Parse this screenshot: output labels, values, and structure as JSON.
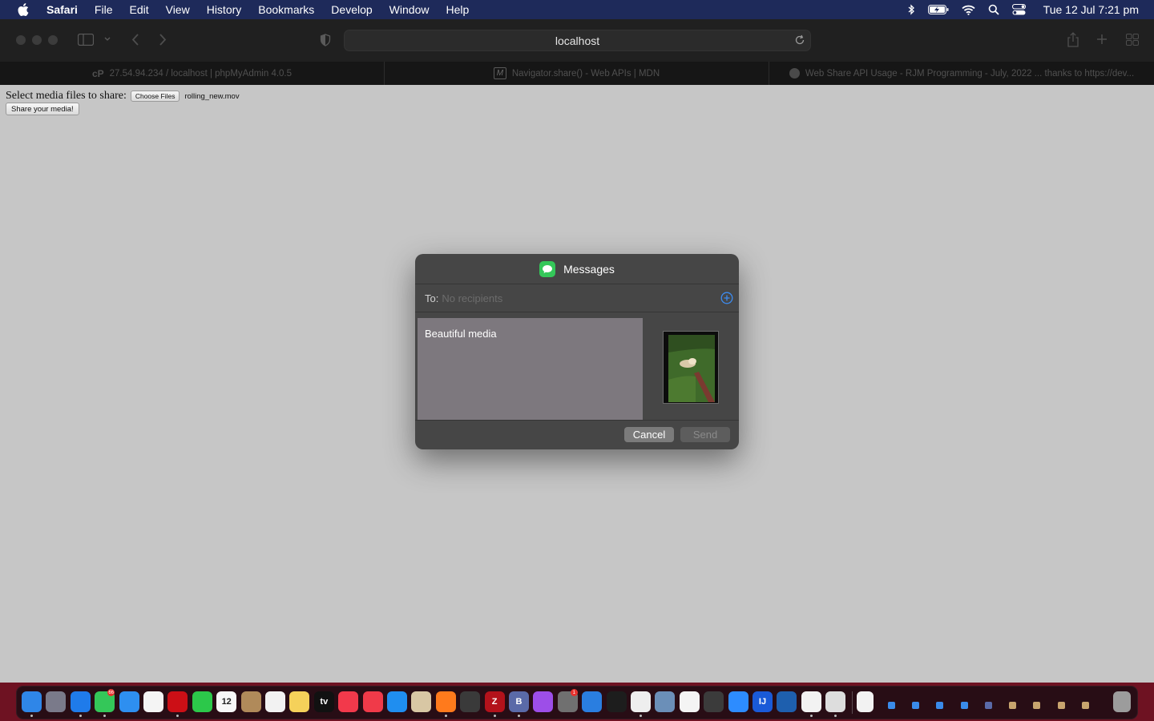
{
  "menubar": {
    "app_name": "Safari",
    "items": [
      "File",
      "Edit",
      "View",
      "History",
      "Bookmarks",
      "Develop",
      "Window",
      "Help"
    ],
    "status_icons": [
      "bluetooth-icon",
      "battery-icon",
      "wifi-icon",
      "spotlight-icon",
      "control-center-icon"
    ],
    "clock": "Tue 12 Jul  7:21 pm"
  },
  "browser": {
    "address": "localhost",
    "tabs": [
      {
        "icon": "cpanel",
        "icon_text": "cP",
        "title": "27.54.94.234 / localhost | phpMyAdmin 4.0.5"
      },
      {
        "icon": "mdn",
        "icon_text": "M",
        "title": "Navigator.share() - Web APIs | MDN"
      },
      {
        "icon": "rjm",
        "icon_text": "",
        "title": "Web Share API Usage - RJM Programming - July, 2022 ... thanks to https://dev..."
      }
    ]
  },
  "page": {
    "prompt": "Select media files to share:",
    "choose_label": "Choose Files",
    "filename": "rolling_new.mov",
    "share_label": "Share your media!"
  },
  "share_sheet": {
    "title": "Messages",
    "to_label": "To:",
    "to_placeholder": "No recipients",
    "message": "Beautiful media",
    "cancel_label": "Cancel",
    "send_label": "Send"
  },
  "dock": {
    "items": [
      {
        "name": "finder",
        "color": "#2f86e8",
        "running": true
      },
      {
        "name": "launchpad",
        "color": "#7a7a8a",
        "running": false
      },
      {
        "name": "safari",
        "color": "#1f7bea",
        "running": true
      },
      {
        "name": "messages",
        "color": "#34c759",
        "running": true,
        "badge": "66"
      },
      {
        "name": "mail",
        "color": "#2e8ff0",
        "running": false
      },
      {
        "name": "photos",
        "color": "#f4f4f4",
        "running": false
      },
      {
        "name": "opera",
        "color": "#cc0f16",
        "running": true
      },
      {
        "name": "facetime",
        "color": "#2cc84a",
        "running": false
      },
      {
        "name": "calendar",
        "color": "#f7f7f7",
        "running": false,
        "text": "12"
      },
      {
        "name": "contacts",
        "color": "#b08a5a",
        "running": false
      },
      {
        "name": "reminders",
        "color": "#f2f2f2",
        "running": false
      },
      {
        "name": "notes",
        "color": "#f5d15a",
        "running": false
      },
      {
        "name": "tv",
        "color": "#111111",
        "running": false,
        "text": "tv"
      },
      {
        "name": "music",
        "color": "#f2394b",
        "running": false
      },
      {
        "name": "news",
        "color": "#f03a49",
        "running": false
      },
      {
        "name": "app-store",
        "color": "#1f8ef0",
        "running": false
      },
      {
        "name": "chess",
        "color": "#d8c7a4",
        "running": false
      },
      {
        "name": "firefox",
        "color": "#ff7a1c",
        "running": true
      },
      {
        "name": "calculator",
        "color": "#3a3a3a",
        "running": false
      },
      {
        "name": "filezilla",
        "color": "#b3121b",
        "running": true,
        "text": "Z"
      },
      {
        "name": "bbedit",
        "color": "#5a6aa8",
        "running": true,
        "text": "B"
      },
      {
        "name": "podcasts",
        "color": "#9d4ee8",
        "running": false
      },
      {
        "name": "system-preferences",
        "color": "#707070",
        "running": false,
        "badge": "1"
      },
      {
        "name": "xcode",
        "color": "#2a7ee0",
        "running": false
      },
      {
        "name": "terminal",
        "color": "#1d1d1d",
        "running": false
      },
      {
        "name": "gimp",
        "color": "#eeeeee",
        "running": true
      },
      {
        "name": "preview",
        "color": "#6b8fb8",
        "running": false
      },
      {
        "name": "textedit",
        "color": "#f4f4f4",
        "running": false
      },
      {
        "name": "script-editor",
        "color": "#3b3b3b",
        "running": false
      },
      {
        "name": "zoom",
        "color": "#2d8cff",
        "running": false
      },
      {
        "name": "intellij",
        "color": "#1a5ad8",
        "running": false,
        "text": "IJ"
      },
      {
        "name": "quicktime",
        "color": "#1e5fae",
        "running": false
      },
      {
        "name": "chrome",
        "color": "#f2f2f2",
        "running": true
      },
      {
        "name": "automator",
        "color": "#dddddd",
        "running": true
      }
    ],
    "minimized": [
      {
        "name": "minimized-chrome-window",
        "color": "#f2f2f2"
      },
      {
        "name": "minimized-finder-window",
        "color": "#3a8bea"
      },
      {
        "name": "minimized-finder-window",
        "color": "#3a8bea"
      },
      {
        "name": "minimized-finder-window",
        "color": "#3a8bea"
      },
      {
        "name": "minimized-finder-window",
        "color": "#3a8bea"
      },
      {
        "name": "minimized-window",
        "color": "#5a6aa8"
      },
      {
        "name": "minimized-window",
        "color": "#c8a46e"
      },
      {
        "name": "minimized-window",
        "color": "#c8a46e"
      },
      {
        "name": "minimized-window",
        "color": "#c8a46e"
      },
      {
        "name": "minimized-window",
        "color": "#c8a46e"
      },
      {
        "name": "trash",
        "color": "#9c9c9c"
      }
    ]
  }
}
